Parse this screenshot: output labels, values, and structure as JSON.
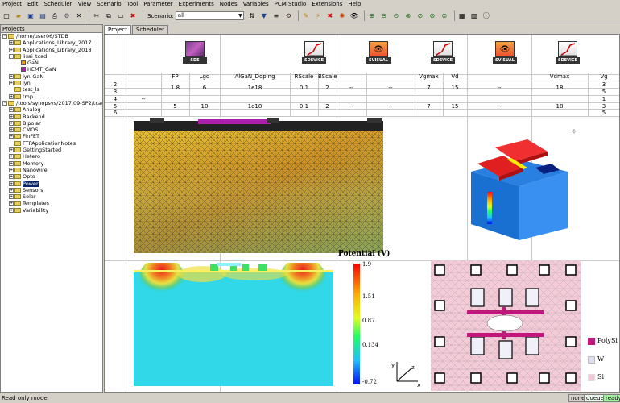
{
  "menu": [
    "Project",
    "Edit",
    "Scheduler",
    "View",
    "Scenario",
    "Tool",
    "Parameter",
    "Experiments",
    "Nodes",
    "Variables",
    "PCM Studio",
    "Extensions",
    "Help"
  ],
  "toolbar": {
    "scenario_label": "Scenario:",
    "scenario_value": "all"
  },
  "left_panel": {
    "title": "Projects",
    "items": [
      {
        "label": "/home/user06/STDB",
        "indent": 0,
        "expander": "-",
        "kind": "folder"
      },
      {
        "label": "Applications_Library_2017",
        "indent": 1,
        "expander": "+",
        "kind": "folder"
      },
      {
        "label": "Applications_Library_2018",
        "indent": 1,
        "expander": "+",
        "kind": "folder"
      },
      {
        "label": "lisai_tcad",
        "indent": 1,
        "expander": "-",
        "kind": "folder"
      },
      {
        "label": "GaN",
        "indent": 2,
        "expander": "",
        "kind": "node-orange"
      },
      {
        "label": "HEMT_GaN",
        "indent": 2,
        "expander": "",
        "kind": "node-purple"
      },
      {
        "label": "lyn-GaN",
        "indent": 1,
        "expander": "+",
        "kind": "folder"
      },
      {
        "label": "lyn",
        "indent": 1,
        "expander": "+",
        "kind": "folder"
      },
      {
        "label": "test_ls",
        "indent": 1,
        "expander": "",
        "kind": "folder"
      },
      {
        "label": "tmp",
        "indent": 1,
        "expander": "+",
        "kind": "folder"
      },
      {
        "label": "/tools/synopsys/2017.09-SP2/tcad",
        "indent": 0,
        "expander": "-",
        "kind": "folder"
      },
      {
        "label": "Analog",
        "indent": 1,
        "expander": "+",
        "kind": "folder"
      },
      {
        "label": "Backend",
        "indent": 1,
        "expander": "+",
        "kind": "folder"
      },
      {
        "label": "Bipolar",
        "indent": 1,
        "expander": "+",
        "kind": "folder"
      },
      {
        "label": "CMOS",
        "indent": 1,
        "expander": "+",
        "kind": "folder"
      },
      {
        "label": "FinFET",
        "indent": 1,
        "expander": "+",
        "kind": "folder"
      },
      {
        "label": "FTPApplicationNotes",
        "indent": 1,
        "expander": "",
        "kind": "folder"
      },
      {
        "label": "GettingStarted",
        "indent": 1,
        "expander": "+",
        "kind": "folder"
      },
      {
        "label": "Hetero",
        "indent": 1,
        "expander": "+",
        "kind": "folder"
      },
      {
        "label": "Memory",
        "indent": 1,
        "expander": "+",
        "kind": "folder"
      },
      {
        "label": "Nanowire",
        "indent": 1,
        "expander": "+",
        "kind": "folder"
      },
      {
        "label": "Opto",
        "indent": 1,
        "expander": "+",
        "kind": "folder"
      },
      {
        "label": "Power",
        "indent": 1,
        "expander": "+",
        "kind": "folder",
        "selected": true
      },
      {
        "label": "Sensors",
        "indent": 1,
        "expander": "+",
        "kind": "folder"
      },
      {
        "label": "Solar",
        "indent": 1,
        "expander": "+",
        "kind": "folder"
      },
      {
        "label": "Templates",
        "indent": 1,
        "expander": "+",
        "kind": "folder"
      },
      {
        "label": "Variability",
        "indent": 1,
        "expander": "+",
        "kind": "folder"
      }
    ]
  },
  "tabs": [
    "Project",
    "Scheduler"
  ],
  "tools": [
    {
      "label": "SDE",
      "name": "sde"
    },
    {
      "label": "SDEVICE",
      "name": "sdevice-1"
    },
    {
      "label": "SVISUAL",
      "name": "svisual-1"
    },
    {
      "label": "SDEVICE",
      "name": "sdevice-2"
    },
    {
      "label": "SVISUAL",
      "name": "svisual-2"
    },
    {
      "label": "SDEVICE",
      "name": "sdevice-3"
    }
  ],
  "columns": [
    "FP",
    "Lgd",
    "AlGaN_Doping",
    "RScale",
    "BScale",
    "Vgmax",
    "Vd",
    "Vdmax",
    "Vg"
  ],
  "row_numbers": [
    "2",
    "3",
    "4",
    "5",
    "6"
  ],
  "rows": [
    {
      "FP": "1.8",
      "Lgd": "6",
      "AlGaN_Doping": "1e18",
      "dash1": "--",
      "RScale": "0.1",
      "BScale": "2",
      "dash2": "--",
      "Vgmax": "7",
      "Vd": "15",
      "dash3": "--",
      "Vdmax": "18",
      "Vg": [
        "3",
        "5"
      ]
    },
    {
      "FP": "5",
      "Lgd": "10",
      "AlGaN_Doping": "1e18",
      "dash1": "--",
      "RScale": "0.1",
      "BScale": "2",
      "dash2": "--",
      "Vgmax": "7",
      "Vd": "15",
      "dash3": "--",
      "Vdmax": "18",
      "Vg": [
        "1",
        "3",
        "5"
      ]
    }
  ],
  "side_dash": "--",
  "colorbar": {
    "title": "Potential (V)",
    "ticks": [
      "1.9",
      "1.51",
      "0.87",
      "0.134",
      "-0.72"
    ]
  },
  "legend": [
    {
      "label": "PolySi",
      "color": "#c0187a"
    },
    {
      "label": "W",
      "color": "#ddddf0"
    },
    {
      "label": "Si",
      "color": "#f2c8d4"
    }
  ],
  "axes_labels": {
    "x": "x",
    "y": "y",
    "z": "z"
  },
  "status": {
    "text": "Read only mode",
    "boxes": [
      "none",
      "queued",
      "ready"
    ]
  }
}
